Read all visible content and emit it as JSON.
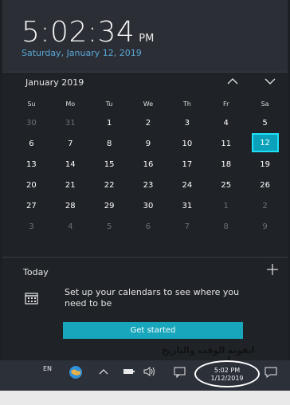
{
  "clock": {
    "time": "5:02:34",
    "ampm": "PM",
    "date": "Saturday, January 12, 2019"
  },
  "calendar": {
    "month_label": "January 2019",
    "weekdays": [
      "Su",
      "Mo",
      "Tu",
      "We",
      "Th",
      "Fr",
      "Sa"
    ],
    "days": [
      {
        "n": "30",
        "dim": true
      },
      {
        "n": "31",
        "dim": true
      },
      {
        "n": "1"
      },
      {
        "n": "2"
      },
      {
        "n": "3"
      },
      {
        "n": "4"
      },
      {
        "n": "5"
      },
      {
        "n": "6"
      },
      {
        "n": "7"
      },
      {
        "n": "8"
      },
      {
        "n": "9"
      },
      {
        "n": "10"
      },
      {
        "n": "11"
      },
      {
        "n": "12",
        "today": true
      },
      {
        "n": "13"
      },
      {
        "n": "14"
      },
      {
        "n": "15"
      },
      {
        "n": "16"
      },
      {
        "n": "17"
      },
      {
        "n": "18"
      },
      {
        "n": "19"
      },
      {
        "n": "20"
      },
      {
        "n": "21"
      },
      {
        "n": "22"
      },
      {
        "n": "23"
      },
      {
        "n": "24"
      },
      {
        "n": "25"
      },
      {
        "n": "26"
      },
      {
        "n": "27"
      },
      {
        "n": "28"
      },
      {
        "n": "29"
      },
      {
        "n": "30"
      },
      {
        "n": "31"
      },
      {
        "n": "1",
        "dim": true
      },
      {
        "n": "2",
        "dim": true
      },
      {
        "n": "3",
        "dim": true
      },
      {
        "n": "4",
        "dim": true
      },
      {
        "n": "5",
        "dim": true
      },
      {
        "n": "6",
        "dim": true
      },
      {
        "n": "7",
        "dim": true
      },
      {
        "n": "8",
        "dim": true
      },
      {
        "n": "9",
        "dim": true
      }
    ],
    "prev_icon": "chevron-up-icon",
    "next_icon": "chevron-down-icon"
  },
  "agenda": {
    "today_label": "Today",
    "add_icon": "plus-icon",
    "setup_text": "Set up your calendars to see where you need to be",
    "get_started_label": "Get started"
  },
  "annotation": {
    "text": "ايقونة الوقت والتاريخ"
  },
  "taskbar": {
    "language": "EN",
    "icons": [
      "network-globe-icon",
      "chevron-up-icon",
      "battery-icon",
      "volume-icon",
      "notifications-icon",
      "action-center-icon"
    ],
    "clock_time": "5:02 PM",
    "clock_date": "1/12/2019"
  },
  "colors": {
    "accent": "#0ba1bb",
    "date_link": "#5aa8d8",
    "flyout_bg": "#1f2227",
    "taskbar_bg": "#2c3039"
  }
}
